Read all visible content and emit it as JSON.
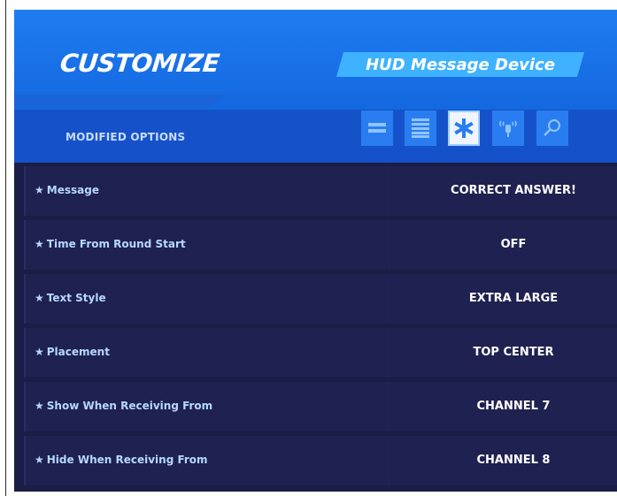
{
  "header": {
    "title": "CUSTOMIZE",
    "device_name": "HUD Message Device"
  },
  "subbar": {
    "label": "MODIFIED OPTIONS",
    "filters": [
      {
        "icon": "compact-list-icon",
        "active": false
      },
      {
        "icon": "full-list-icon",
        "active": false
      },
      {
        "icon": "star-icon",
        "active": true
      },
      {
        "icon": "channel-icon",
        "active": false
      },
      {
        "icon": "search-icon",
        "active": false
      }
    ]
  },
  "options": [
    {
      "label": "Message",
      "value": "CORRECT ANSWER!"
    },
    {
      "label": "Time From Round Start",
      "value": "OFF"
    },
    {
      "label": "Text Style",
      "value": "EXTRA LARGE"
    },
    {
      "label": "Placement",
      "value": "TOP CENTER"
    },
    {
      "label": "Show When Receiving From",
      "value": "CHANNEL 7"
    },
    {
      "label": "Hide When Receiving From",
      "value": "CHANNEL 8"
    }
  ],
  "colors": {
    "header_blue": "#1f7cf0",
    "subbar_blue": "#1552c9",
    "badge_cyan": "#3fb2ff",
    "row_bg": "#1f2150",
    "label_text": "#b7d8ff"
  }
}
